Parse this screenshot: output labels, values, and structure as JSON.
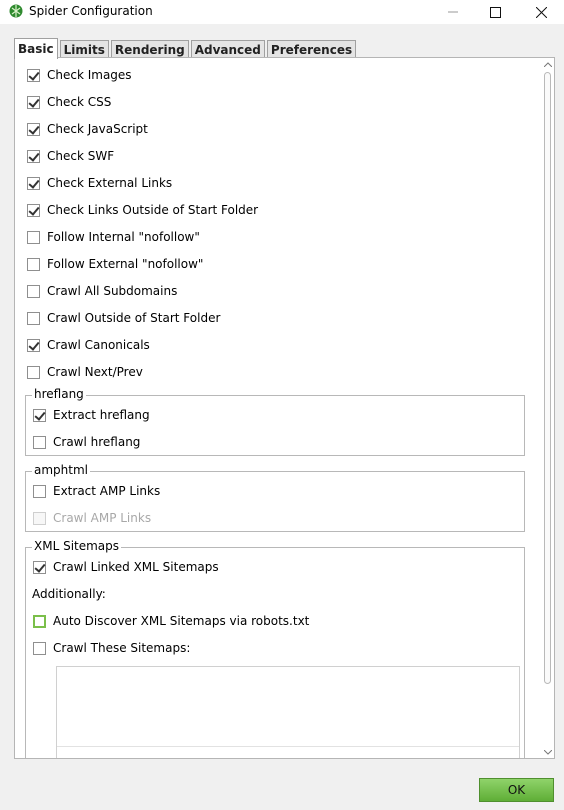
{
  "window": {
    "title": "Spider Configuration"
  },
  "tabs": [
    {
      "label": "Basic",
      "active": true
    },
    {
      "label": "Limits",
      "active": false
    },
    {
      "label": "Rendering",
      "active": false
    },
    {
      "label": "Advanced",
      "active": false
    },
    {
      "label": "Preferences",
      "active": false
    }
  ],
  "options": [
    {
      "label": "Check Images",
      "checked": true
    },
    {
      "label": "Check CSS",
      "checked": true
    },
    {
      "label": "Check JavaScript",
      "checked": true
    },
    {
      "label": "Check SWF",
      "checked": true
    },
    {
      "label": "Check External Links",
      "checked": true
    },
    {
      "label": "Check Links Outside of Start Folder",
      "checked": true
    },
    {
      "label": "Follow Internal \"nofollow\"",
      "checked": false
    },
    {
      "label": "Follow External \"nofollow\"",
      "checked": false
    },
    {
      "label": "Crawl All Subdomains",
      "checked": false
    },
    {
      "label": "Crawl Outside of Start Folder",
      "checked": false
    },
    {
      "label": "Crawl Canonicals",
      "checked": true
    },
    {
      "label": "Crawl Next/Prev",
      "checked": false
    }
  ],
  "hreflang": {
    "title": "hreflang",
    "items": [
      {
        "label": "Extract hreflang",
        "checked": true
      },
      {
        "label": "Crawl hreflang",
        "checked": false
      }
    ]
  },
  "amphtml": {
    "title": "amphtml",
    "items": [
      {
        "label": "Extract AMP Links",
        "checked": false
      },
      {
        "label": "Crawl AMP Links",
        "checked": false,
        "disabled": true
      }
    ]
  },
  "sitemaps": {
    "title": "XML Sitemaps",
    "crawl_linked": {
      "label": "Crawl Linked XML Sitemaps",
      "checked": true
    },
    "additionally": "Additionally:",
    "auto_discover": {
      "label": "Auto Discover XML Sitemaps via robots.txt",
      "checked": false
    },
    "crawl_these": {
      "label": "Crawl These Sitemaps:",
      "checked": false
    }
  },
  "buttons": {
    "ok": "OK"
  },
  "colors": {
    "ok_green": "#6cc04a",
    "focus_green": "#7bbf4a"
  }
}
